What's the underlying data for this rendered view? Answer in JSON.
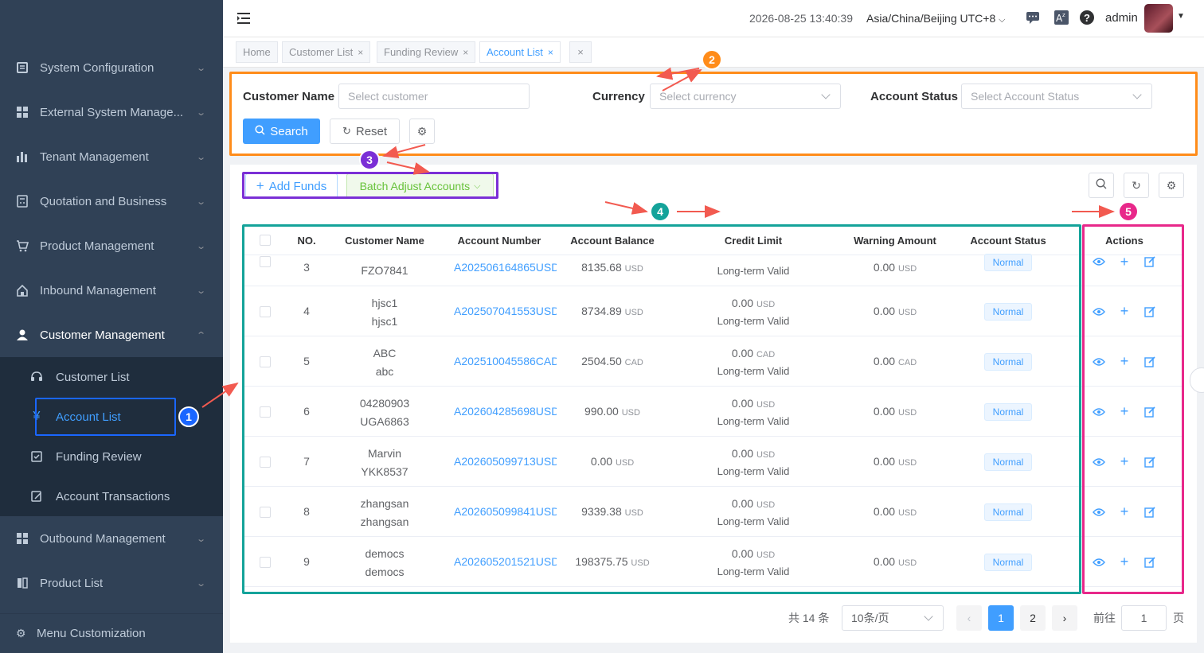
{
  "sidebar": {
    "items": [
      {
        "label": "System Configuration"
      },
      {
        "label": "External System Manage..."
      },
      {
        "label": "Tenant Management"
      },
      {
        "label": "Quotation and Business"
      },
      {
        "label": "Product Management"
      },
      {
        "label": "Inbound Management"
      },
      {
        "label": "Customer Management"
      },
      {
        "label": "Outbound Management"
      },
      {
        "label": "Product List"
      }
    ],
    "subitems": [
      {
        "label": "Customer List"
      },
      {
        "label": "Account List"
      },
      {
        "label": "Funding Review"
      },
      {
        "label": "Account Transactions"
      }
    ],
    "menu_customization": "Menu Customization"
  },
  "header": {
    "datetime": "2026-08-25 13:40:39",
    "timezone": "Asia/China/Beijing UTC+8",
    "user": "admin"
  },
  "tabs": [
    {
      "label": "Home"
    },
    {
      "label": "Customer List"
    },
    {
      "label": "Funding Review"
    },
    {
      "label": "Account List"
    }
  ],
  "filters": {
    "customer_label": "Customer Name",
    "customer_placeholder": "Select customer",
    "currency_label": "Currency",
    "currency_placeholder": "Select currency",
    "status_label": "Account Status",
    "status_placeholder": "Select Account Status",
    "search": "Search",
    "reset": "Reset"
  },
  "toolbar": {
    "add_funds": "Add Funds",
    "batch_adjust": "Batch Adjust Accounts"
  },
  "table": {
    "headers": [
      "NO.",
      "Customer Name",
      "Account Number",
      "Account Balance",
      "Credit Limit",
      "Warning Amount",
      "Account Status",
      "Actions"
    ],
    "rows": [
      {
        "no": "3",
        "name1": "",
        "name2": "FZO7841",
        "account": "A202506164865USD",
        "balance": "8135.68",
        "balance_unit": "USD",
        "credit": "",
        "credit_unit": "",
        "credit_note": "Long-term Valid",
        "warning": "0.00",
        "warning_unit": "USD",
        "status": "Normal"
      },
      {
        "no": "4",
        "name1": "hjsc1",
        "name2": "hjsc1",
        "account": "A202507041553USD",
        "balance": "8734.89",
        "balance_unit": "USD",
        "credit": "0.00",
        "credit_unit": "USD",
        "credit_note": "Long-term Valid",
        "warning": "0.00",
        "warning_unit": "USD",
        "status": "Normal"
      },
      {
        "no": "5",
        "name1": "ABC",
        "name2": "abc",
        "account": "A202510045586CAD",
        "balance": "2504.50",
        "balance_unit": "CAD",
        "credit": "0.00",
        "credit_unit": "CAD",
        "credit_note": "Long-term Valid",
        "warning": "0.00",
        "warning_unit": "CAD",
        "status": "Normal"
      },
      {
        "no": "6",
        "name1": "04280903",
        "name2": "UGA6863",
        "account": "A202604285698USD",
        "balance": "990.00",
        "balance_unit": "USD",
        "credit": "0.00",
        "credit_unit": "USD",
        "credit_note": "Long-term Valid",
        "warning": "0.00",
        "warning_unit": "USD",
        "status": "Normal"
      },
      {
        "no": "7",
        "name1": "Marvin",
        "name2": "YKK8537",
        "account": "A202605099713USD",
        "balance": "0.00",
        "balance_unit": "USD",
        "credit": "0.00",
        "credit_unit": "USD",
        "credit_note": "Long-term Valid",
        "warning": "0.00",
        "warning_unit": "USD",
        "status": "Normal"
      },
      {
        "no": "8",
        "name1": "zhangsan",
        "name2": "zhangsan",
        "account": "A202605099841USD",
        "balance": "9339.38",
        "balance_unit": "USD",
        "credit": "0.00",
        "credit_unit": "USD",
        "credit_note": "Long-term Valid",
        "warning": "0.00",
        "warning_unit": "USD",
        "status": "Normal"
      },
      {
        "no": "9",
        "name1": "democs",
        "name2": "democs",
        "account": "A202605201521USD",
        "balance": "198375.75",
        "balance_unit": "USD",
        "credit": "0.00",
        "credit_unit": "USD",
        "credit_note": "Long-term Valid",
        "warning": "0.00",
        "warning_unit": "USD",
        "status": "Normal"
      }
    ]
  },
  "pagination": {
    "total": "共 14 条",
    "page_size": "10条/页",
    "pages": [
      "1",
      "2"
    ],
    "goto_label": "前往",
    "goto_value": "1",
    "page_suffix": "页"
  },
  "annotations": {
    "labels": [
      "1",
      "2",
      "3",
      "4",
      "5"
    ],
    "colors": {
      "1": "#1a66ff",
      "2": "#ff8c1a",
      "3": "#7b2fd6",
      "4": "#14a39a",
      "5": "#e8288a"
    }
  },
  "colors": {
    "sidebar_bg": "#304156",
    "accent": "#409eff",
    "batch_green": "#67c23a"
  }
}
